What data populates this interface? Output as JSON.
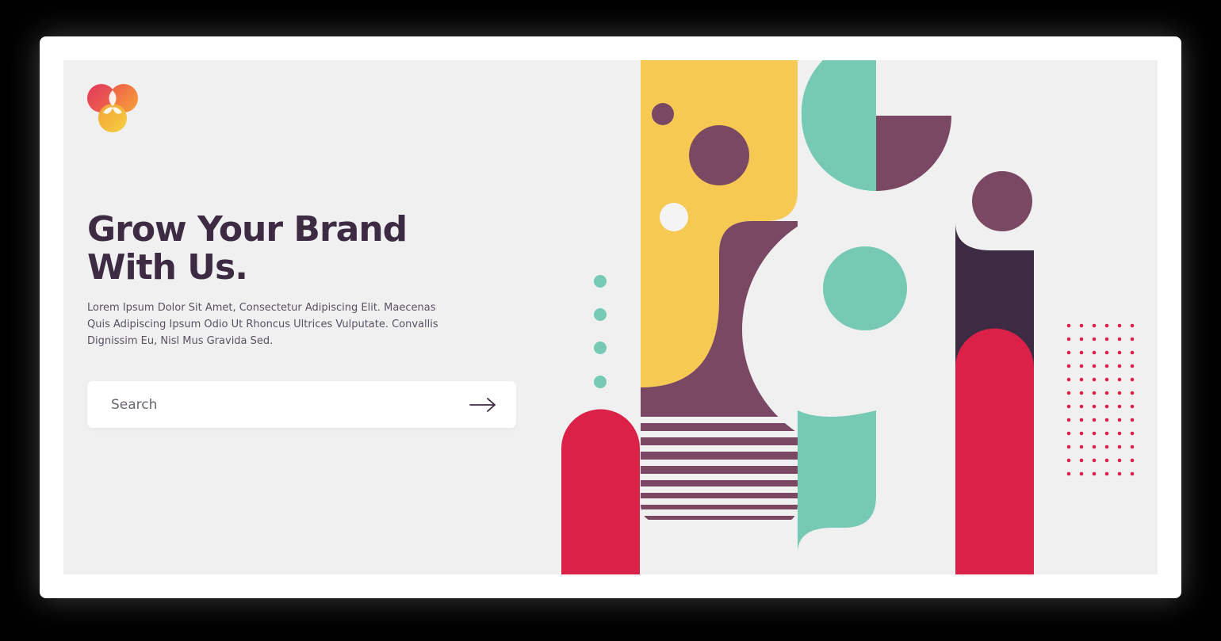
{
  "hero": {
    "headline_line1": "Grow Your Brand",
    "headline_line2": "With Us.",
    "description": "Lorem Ipsum Dolor Sit Amet, Consectetur Adipiscing Elit. Maecenas Quis Adipiscing Ipsum Odio Ut Rhoncus Ultrices Vulputate. Convallis Dignissim Eu, Nisl Mus Gravida Sed."
  },
  "search": {
    "placeholder": "Search",
    "value": ""
  },
  "icons": {
    "logo": "trefoil-logo-icon",
    "submit": "arrow-right-icon"
  },
  "colors": {
    "heading": "#3d2b43",
    "yellow": "#f6c952",
    "plum": "#7b4863",
    "teal": "#76cab3",
    "red": "#dc2149",
    "dark_plum": "#3d2b43",
    "background": "#f0f0f0"
  }
}
